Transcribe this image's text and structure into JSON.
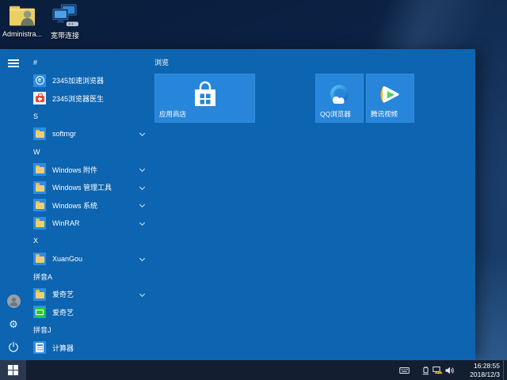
{
  "desktop": {
    "icons": [
      {
        "label": "Administra...",
        "icon": "user-folder-icon"
      },
      {
        "label": "宽带连接",
        "icon": "broadband-connection-icon"
      }
    ]
  },
  "start_menu": {
    "rail_icons": [
      "hamburger-menu-icon",
      "user-avatar-icon",
      "settings-gear-icon",
      "power-icon"
    ],
    "app_list": [
      {
        "type": "header",
        "label": "#"
      },
      {
        "type": "app",
        "label": "2345加速浏览器",
        "icon": "2345-browser-icon"
      },
      {
        "type": "app",
        "label": "2345浏览器医生",
        "icon": "2345-doctor-icon"
      },
      {
        "type": "header",
        "label": "S"
      },
      {
        "type": "folder",
        "label": "softmgr",
        "icon": "folder-icon"
      },
      {
        "type": "header",
        "label": "W"
      },
      {
        "type": "folder",
        "label": "Windows 附件",
        "icon": "folder-icon"
      },
      {
        "type": "folder",
        "label": "Windows 管理工具",
        "icon": "folder-icon"
      },
      {
        "type": "folder",
        "label": "Windows 系统",
        "icon": "folder-icon"
      },
      {
        "type": "folder",
        "label": "WinRAR",
        "icon": "folder-icon"
      },
      {
        "type": "header",
        "label": "X"
      },
      {
        "type": "folder",
        "label": "XuanGou",
        "icon": "folder-icon"
      },
      {
        "type": "header",
        "label": "拼音A"
      },
      {
        "type": "folder",
        "label": "爱奇艺",
        "icon": "folder-icon"
      },
      {
        "type": "app",
        "label": "爱奇艺",
        "icon": "iqiyi-icon"
      },
      {
        "type": "header",
        "label": "拼音J"
      },
      {
        "type": "app",
        "label": "计算器",
        "icon": "calculator-icon"
      }
    ],
    "tiles": {
      "group_label": "浏览",
      "items": [
        {
          "label": "应用商店",
          "icon": "store-icon",
          "size": "wide"
        },
        {
          "label": "QQ浏览器",
          "icon": "qq-browser-icon",
          "size": "medium"
        },
        {
          "label": "腾讯视频",
          "icon": "tencent-video-icon",
          "size": "medium"
        }
      ]
    }
  },
  "taskbar": {
    "start_icon": "windows-logo-icon",
    "tray_icons": [
      "touch-keyboard-icon",
      "usb-device-icon",
      "network-warning-icon",
      "volume-icon"
    ],
    "clock": {
      "time": "16:28:55",
      "date": "2018/12/3"
    }
  },
  "colors": {
    "menu_background": "#0d64b0",
    "tile_background": "#2786d9",
    "taskbar_background": "#141e31",
    "warning_yellow": "#f6c21c",
    "iqiyi_green": "#27c93f",
    "folder_yellow": "#f2cf6e"
  }
}
